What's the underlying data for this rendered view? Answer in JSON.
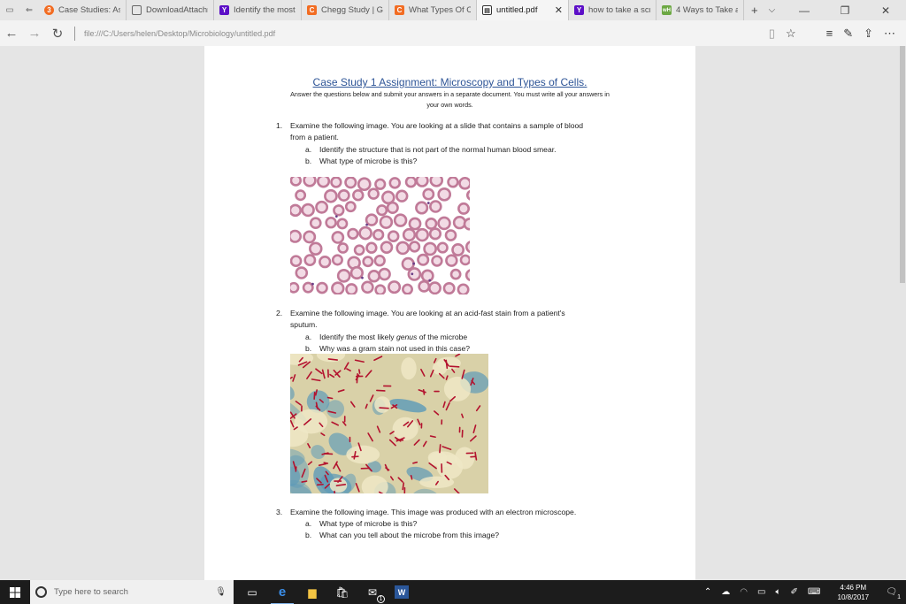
{
  "browser": {
    "tabs": [
      {
        "label": "Case Studies: Assig",
        "favicon": "orange-circle-icon",
        "badge": "3"
      },
      {
        "label": "DownloadAttachm",
        "favicon": "window-icon"
      },
      {
        "label": "Identify the most l",
        "favicon": "yahoo-icon",
        "badge": "Y"
      },
      {
        "label": "Chegg Study | Guic",
        "favicon": "chegg-icon",
        "badge": "C"
      },
      {
        "label": "What Types Of Cel",
        "favicon": "chegg-icon",
        "badge": "C"
      },
      {
        "label": "untitled.pdf",
        "favicon": "pdf-icon",
        "badge": "PDF",
        "active": true
      },
      {
        "label": "how to take a scre",
        "favicon": "yahoo-icon",
        "badge": "Y"
      },
      {
        "label": "4 Ways to Take a S",
        "favicon": "wikihow-icon",
        "badge": "wH"
      }
    ],
    "url": "file:///C:/Users/helen/Desktop/Microbiology/untitled.pdf"
  },
  "document": {
    "title": "Case Study 1 Assignment: Microscopy and Types of Cells.",
    "intro_line1": "Answer the questions below and submit your answers in a separate document. You must write all your answers in",
    "intro_line2": "your own words.",
    "questions": [
      {
        "number": "1.",
        "line1": "Examine the following image. You are looking at a slide that contains a sample of blood",
        "line2": "from a patient.",
        "subs": [
          {
            "label": "a.",
            "text": "Identify the structure that is not part of the normal human blood smear."
          },
          {
            "label": "b.",
            "text": "What type of microbe is this?"
          }
        ]
      },
      {
        "number": "2.",
        "line1": "Examine the following image. You are looking at an acid-fast stain from a patient's",
        "line2": "sputum.",
        "subs": [
          {
            "label": "a.",
            "text_before": "Identify the most likely ",
            "text_italic": "genus",
            "text_after": " of the microbe"
          },
          {
            "label": "b.",
            "text": "Why was a gram stain not used in this case?"
          }
        ]
      },
      {
        "number": "3.",
        "line1": "Examine the following image. This image was produced with an electron microscope.",
        "subs": [
          {
            "label": "a.",
            "text": "What type of microbe is this?"
          },
          {
            "label": "b.",
            "text": "What can you tell about the microbe from this image?"
          }
        ]
      }
    ]
  },
  "taskbar": {
    "search_placeholder": "Type here to search",
    "time": "4:46 PM",
    "date": "10/8/2017",
    "mail_badge": "1",
    "notification_badge": "1"
  },
  "colors": {
    "title_blue": "#2e5597",
    "taskbar": "#1c1c1c",
    "rbc_pink": "#c07a98",
    "acid_fast_red": "#b3122e",
    "counterstain_blue": "#5d9ab8"
  }
}
